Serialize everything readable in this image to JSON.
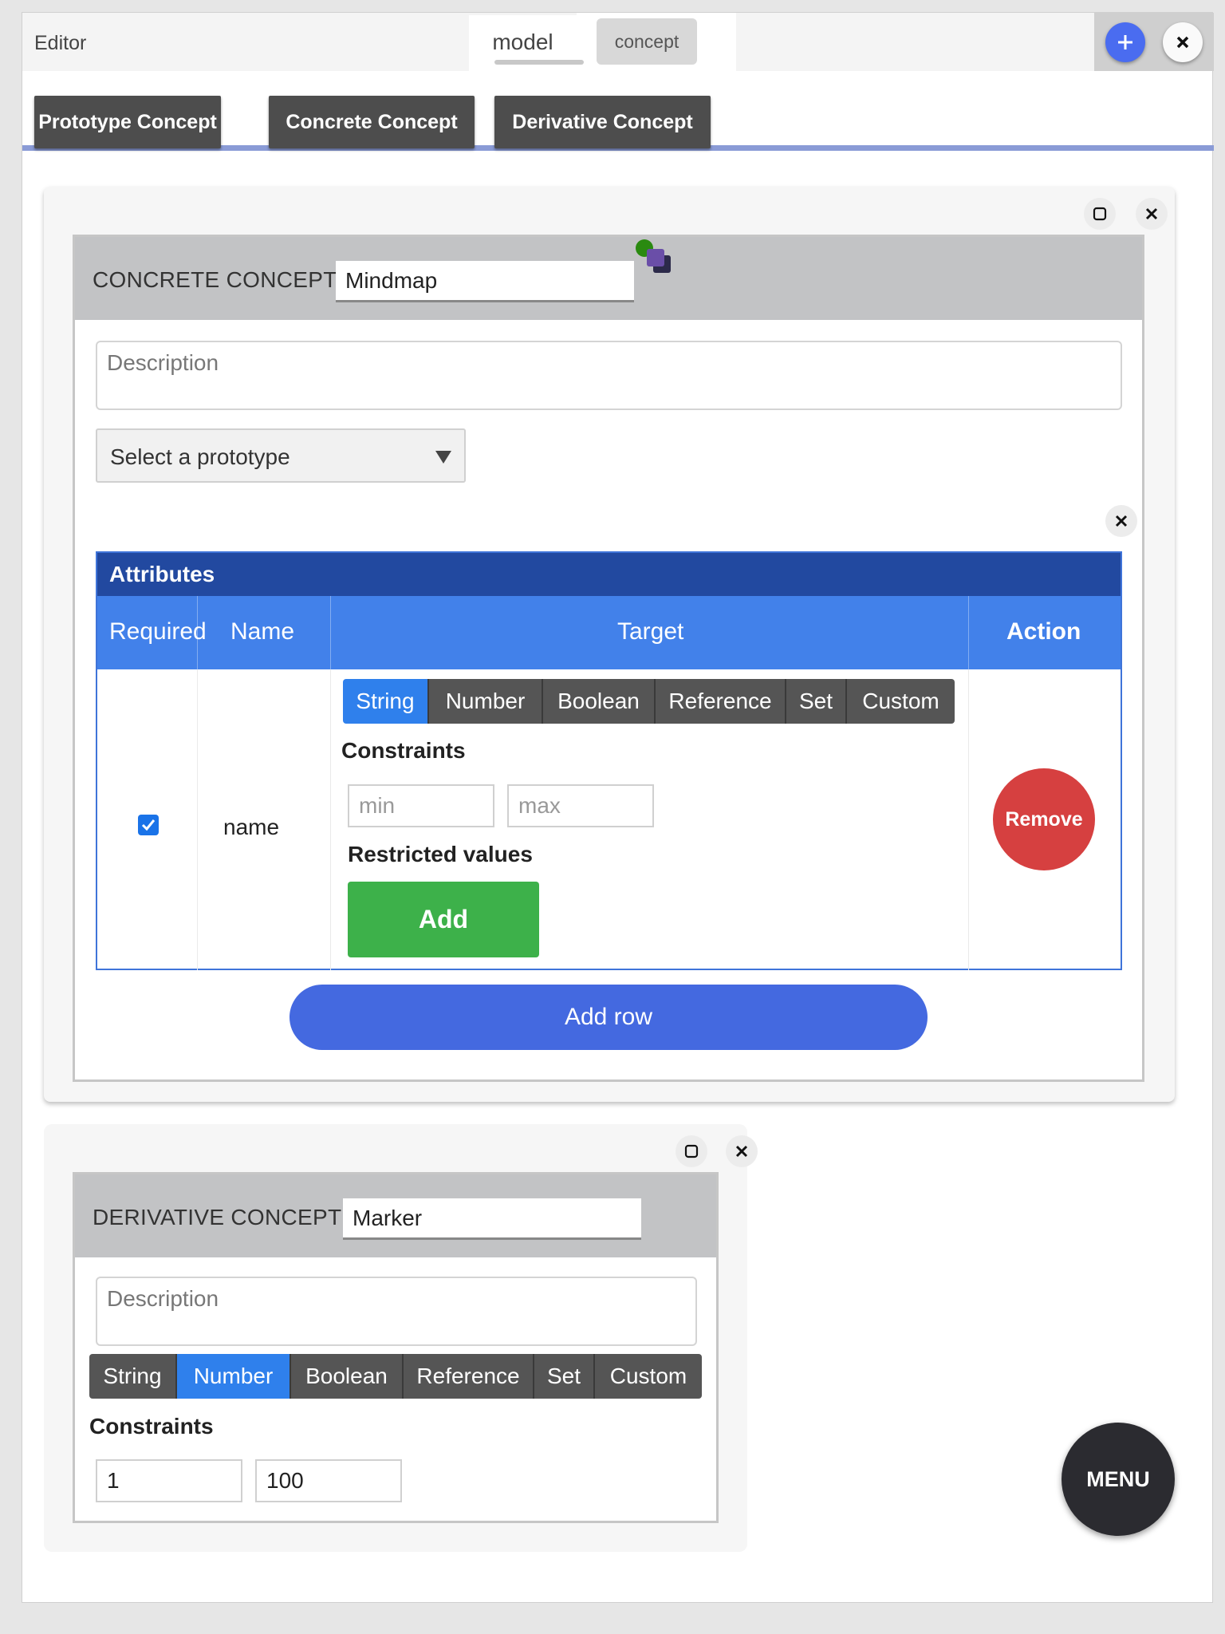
{
  "header": {
    "title": "Editor",
    "tabs": [
      {
        "label": "model",
        "active": true
      },
      {
        "label": "concept",
        "active": false
      }
    ]
  },
  "toolbar": {
    "concept_types": [
      "Prototype Concept",
      "Concrete Concept",
      "Derivative Concept"
    ]
  },
  "concrete_concept": {
    "type_label": "CONCRETE CONCEPT",
    "name_value": "Mindmap",
    "description_placeholder": "Description",
    "prototype_select": "Select a prototype",
    "attributes": {
      "title": "Attributes",
      "headers": {
        "required": "Required",
        "name": "Name",
        "target": "Target",
        "action": "Action"
      },
      "rows": [
        {
          "required": true,
          "name": "name",
          "target_types": [
            "String",
            "Number",
            "Boolean",
            "Reference",
            "Set",
            "Custom"
          ],
          "selected_target": "String",
          "constraints_label": "Constraints",
          "min_placeholder": "min",
          "max_placeholder": "max",
          "restricted_label": "Restricted values",
          "add_label": "Add",
          "remove_label": "Remove"
        }
      ],
      "add_row_label": "Add row"
    }
  },
  "derivative_concept": {
    "type_label": "DERIVATIVE CONCEPT",
    "name_value": "Marker",
    "description_placeholder": "Description",
    "target_types": [
      "String",
      "Number",
      "Boolean",
      "Reference",
      "Set",
      "Custom"
    ],
    "selected_target": "Number",
    "constraints_label": "Constraints",
    "min_value": "1",
    "max_value": "100"
  },
  "menu_label": "MENU",
  "colors": {
    "accent_blue": "#4469e0",
    "table_header": "#4281ea",
    "table_title": "#2249a0",
    "add_green": "#3db14a",
    "remove_red": "#d64040",
    "dark_button": "#4d4d4d"
  }
}
